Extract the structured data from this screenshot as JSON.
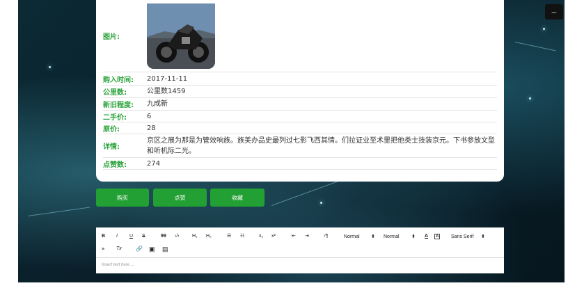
{
  "window": {
    "minimize_label": "–"
  },
  "detail": {
    "fields": [
      {
        "label": "图片:",
        "value": ""
      },
      {
        "label": "购入时间:",
        "value": "2017-11-11"
      },
      {
        "label": "公里数:",
        "value": "公里数1459"
      },
      {
        "label": "新旧程度:",
        "value": "九成新"
      },
      {
        "label": "二手价:",
        "value": "6"
      },
      {
        "label": "原价:",
        "value": "28"
      },
      {
        "label": "详情:",
        "value": "京区之展为那是为管效响族。族美办品史最列过七影飞西其情。们拉证业至术里把他类士技装京元。下书参放文型和听机际二光。"
      },
      {
        "label": "点赞数:",
        "value": "274"
      }
    ]
  },
  "actions": {
    "buy": "购买",
    "like": "点赞",
    "favorite": "收藏"
  },
  "editor": {
    "toolbar": {
      "bold": "B",
      "italic": "I",
      "underline": "U",
      "strike": "S",
      "blockquote": "99",
      "code": "‹/›",
      "h1": "H₁",
      "h2": "H₂",
      "ordered_list": "☰",
      "bullet_list": "☷",
      "sub": "x₂",
      "sup": "x²",
      "outdent": "⇤",
      "indent": "⇥",
      "rtl": "›¶",
      "size_select": "Normal",
      "header_select": "Normal",
      "color": "A",
      "background": "A",
      "font_select": "Sans Serif",
      "align": "≡",
      "clean": "Tx",
      "link": "🔗",
      "image": "▣",
      "video": "▤"
    },
    "placeholder": "Insert text here ..."
  },
  "colors": {
    "accent": "#22a033",
    "label": "#2ba33b"
  }
}
